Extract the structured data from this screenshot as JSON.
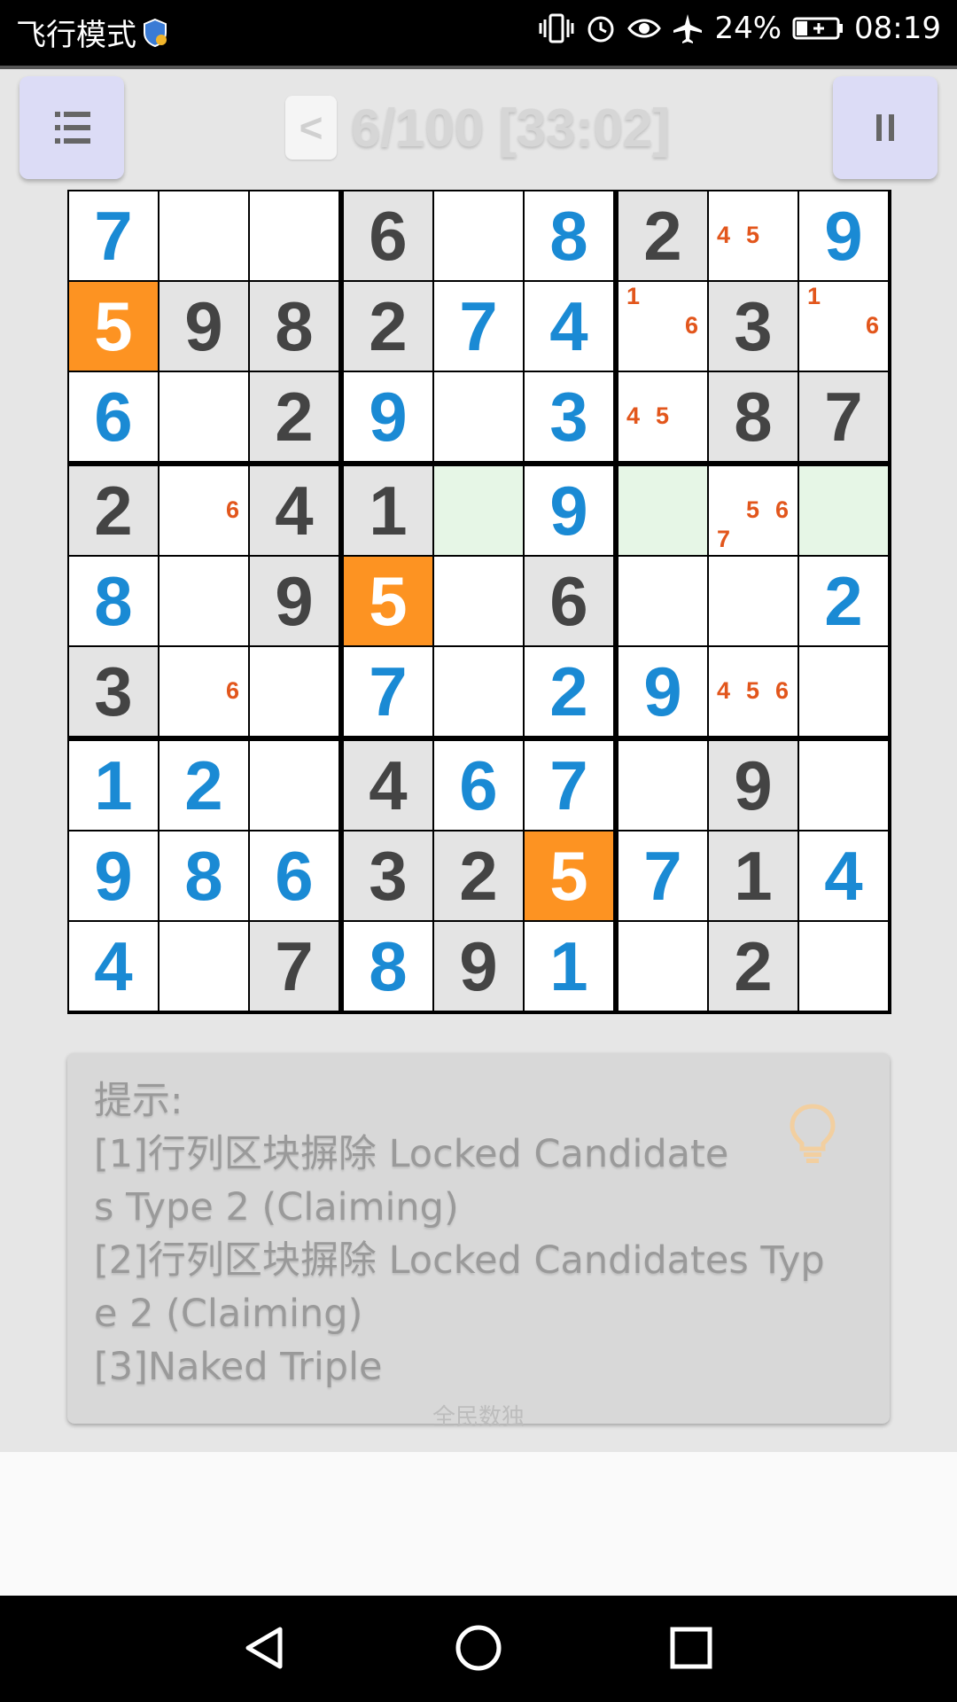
{
  "status_bar": {
    "left_text": "飞行模式",
    "battery": "24%",
    "time": "08:19",
    "icons": [
      "shield-icon",
      "vibrate-icon",
      "alarm-icon",
      "eye-icon",
      "airplane-icon",
      "battery-icon"
    ]
  },
  "header": {
    "menu_icon": "menu-icon",
    "prev_label": "<",
    "progress": "6/100 [33:02]",
    "pause_icon": "pause-icon"
  },
  "colors": {
    "given_bg": "#e4e4e4",
    "given_text": "#444444",
    "user_text": "#1a8ad4",
    "selected_bg": "#fd9322",
    "highlight_bg": "#e6f6e6",
    "note_text": "#e2561c",
    "button_bg": "#dcdcf6"
  },
  "board": {
    "rows": [
      [
        {
          "v": "7",
          "t": "user"
        },
        {
          "t": "empty"
        },
        {
          "t": "empty"
        },
        {
          "v": "6",
          "t": "given"
        },
        {
          "t": "empty"
        },
        {
          "v": "8",
          "t": "user"
        },
        {
          "v": "2",
          "t": "given"
        },
        {
          "t": "empty",
          "notes": [
            "4",
            "5"
          ]
        },
        {
          "v": "9",
          "t": "user"
        }
      ],
      [
        {
          "v": "5",
          "t": "selected"
        },
        {
          "v": "9",
          "t": "given"
        },
        {
          "v": "8",
          "t": "given"
        },
        {
          "v": "2",
          "t": "given"
        },
        {
          "v": "7",
          "t": "user"
        },
        {
          "v": "4",
          "t": "user"
        },
        {
          "t": "empty",
          "notes": [
            "1",
            "6"
          ]
        },
        {
          "v": "3",
          "t": "given"
        },
        {
          "t": "empty",
          "notes": [
            "1",
            "6"
          ]
        }
      ],
      [
        {
          "v": "6",
          "t": "user"
        },
        {
          "t": "empty"
        },
        {
          "v": "2",
          "t": "given"
        },
        {
          "v": "9",
          "t": "user"
        },
        {
          "t": "empty"
        },
        {
          "v": "3",
          "t": "user"
        },
        {
          "t": "empty",
          "notes": [
            "4",
            "5"
          ]
        },
        {
          "v": "8",
          "t": "given"
        },
        {
          "v": "7",
          "t": "given"
        }
      ],
      [
        {
          "v": "2",
          "t": "given"
        },
        {
          "t": "empty",
          "notes": [
            "6"
          ]
        },
        {
          "v": "4",
          "t": "given"
        },
        {
          "v": "1",
          "t": "given"
        },
        {
          "t": "highlight"
        },
        {
          "v": "9",
          "t": "user"
        },
        {
          "t": "highlight"
        },
        {
          "t": "empty",
          "notes": [
            "5",
            "6",
            "7"
          ]
        },
        {
          "t": "highlight"
        }
      ],
      [
        {
          "v": "8",
          "t": "user"
        },
        {
          "t": "empty"
        },
        {
          "v": "9",
          "t": "given"
        },
        {
          "v": "5",
          "t": "selected"
        },
        {
          "t": "empty"
        },
        {
          "v": "6",
          "t": "given"
        },
        {
          "t": "empty"
        },
        {
          "t": "empty"
        },
        {
          "v": "2",
          "t": "user"
        }
      ],
      [
        {
          "v": "3",
          "t": "given"
        },
        {
          "t": "empty",
          "notes": [
            "6"
          ]
        },
        {
          "t": "empty"
        },
        {
          "v": "7",
          "t": "user"
        },
        {
          "t": "empty"
        },
        {
          "v": "2",
          "t": "user"
        },
        {
          "v": "9",
          "t": "user"
        },
        {
          "t": "empty",
          "notes": [
            "4",
            "5",
            "6"
          ]
        },
        {
          "t": "empty"
        }
      ],
      [
        {
          "v": "1",
          "t": "user"
        },
        {
          "v": "2",
          "t": "user"
        },
        {
          "t": "empty"
        },
        {
          "v": "4",
          "t": "given"
        },
        {
          "v": "6",
          "t": "user"
        },
        {
          "v": "7",
          "t": "user"
        },
        {
          "t": "empty"
        },
        {
          "v": "9",
          "t": "given"
        },
        {
          "t": "empty"
        }
      ],
      [
        {
          "v": "9",
          "t": "user"
        },
        {
          "v": "8",
          "t": "user"
        },
        {
          "v": "6",
          "t": "user"
        },
        {
          "v": "3",
          "t": "given"
        },
        {
          "v": "2",
          "t": "given"
        },
        {
          "v": "5",
          "t": "selected"
        },
        {
          "v": "7",
          "t": "user"
        },
        {
          "v": "1",
          "t": "given"
        },
        {
          "v": "4",
          "t": "user"
        }
      ],
      [
        {
          "v": "4",
          "t": "user"
        },
        {
          "t": "empty"
        },
        {
          "v": "7",
          "t": "given"
        },
        {
          "v": "8",
          "t": "user"
        },
        {
          "v": "9",
          "t": "given"
        },
        {
          "v": "1",
          "t": "user"
        },
        {
          "t": "empty"
        },
        {
          "v": "2",
          "t": "given"
        },
        {
          "t": "empty"
        }
      ]
    ]
  },
  "hint": {
    "lines": [
      "提示:",
      "[1]行列区块摒除 Locked Candidate",
      "s Type 2 (Claiming)",
      "[2]行列区块摒除 Locked Candidates Typ",
      "e 2 (Claiming)",
      "[3]Naked Triple"
    ],
    "icon": "lightbulb-icon",
    "brand": "全民数独"
  },
  "nav_bar": {
    "icons": [
      "back-icon",
      "home-icon",
      "recents-icon"
    ]
  }
}
